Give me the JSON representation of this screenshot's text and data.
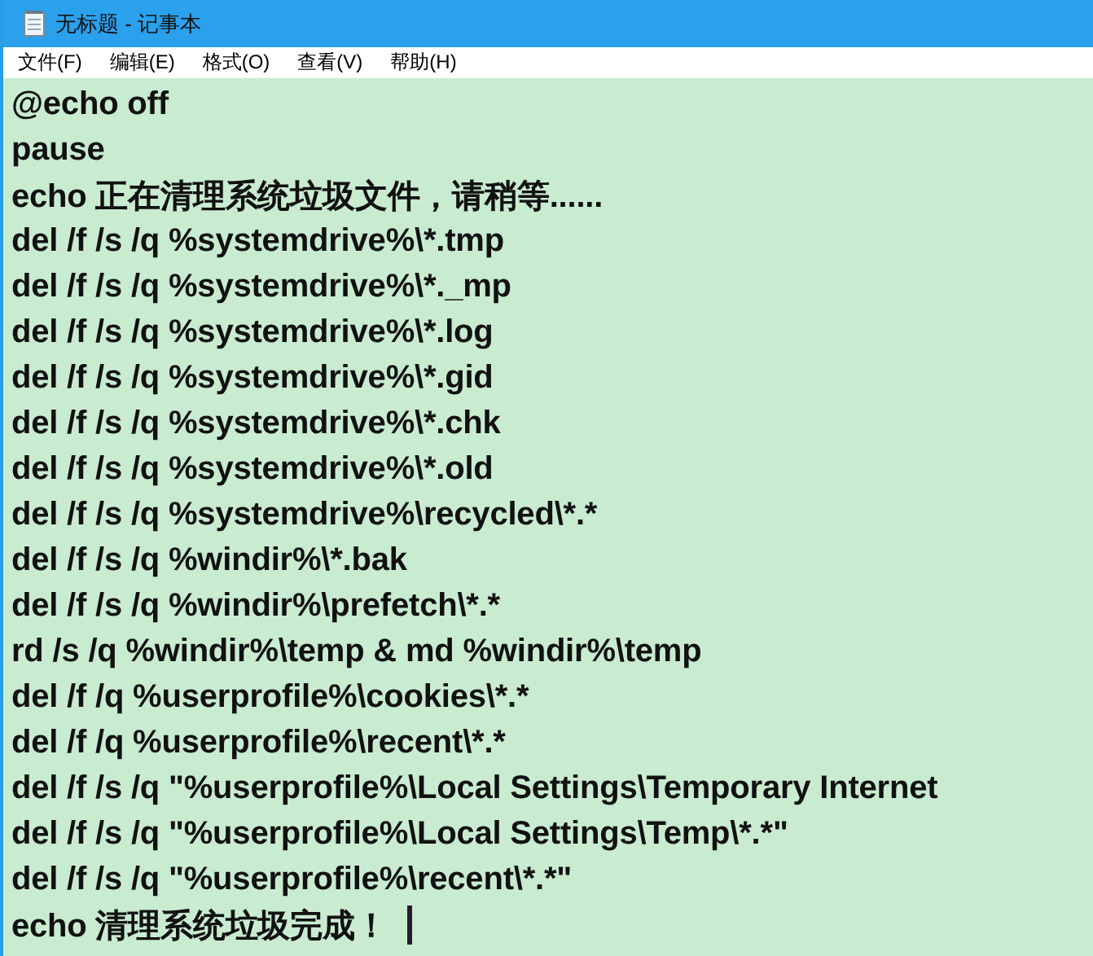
{
  "window": {
    "title": "无标题 - 记事本"
  },
  "menu": [
    "文件(F)",
    "编辑(E)",
    "格式(O)",
    "查看(V)",
    "帮助(H)"
  ],
  "editor": {
    "lines": [
      "@echo off",
      "pause",
      "echo 正在清理系统垃圾文件，请稍等......",
      "del /f /s /q %systemdrive%\\*.tmp",
      "del /f /s /q %systemdrive%\\*._mp",
      "del /f /s /q %systemdrive%\\*.log",
      "del /f /s /q %systemdrive%\\*.gid",
      "del /f /s /q %systemdrive%\\*.chk",
      "del /f /s /q %systemdrive%\\*.old",
      "del /f /s /q %systemdrive%\\recycled\\*.*",
      "del /f /s /q %windir%\\*.bak",
      "del /f /s /q %windir%\\prefetch\\*.*",
      "rd /s /q %windir%\\temp & md %windir%\\temp",
      "del /f /q %userprofile%\\cookies\\*.*",
      "del /f /q %userprofile%\\recent\\*.*",
      "del /f /s /q \"%userprofile%\\Local Settings\\Temporary Internet",
      "del /f /s /q \"%userprofile%\\Local Settings\\Temp\\*.*\"",
      "del /f /s /q \"%userprofile%\\recent\\*.*\"",
      "echo 清理系统垃圾完成！"
    ]
  }
}
